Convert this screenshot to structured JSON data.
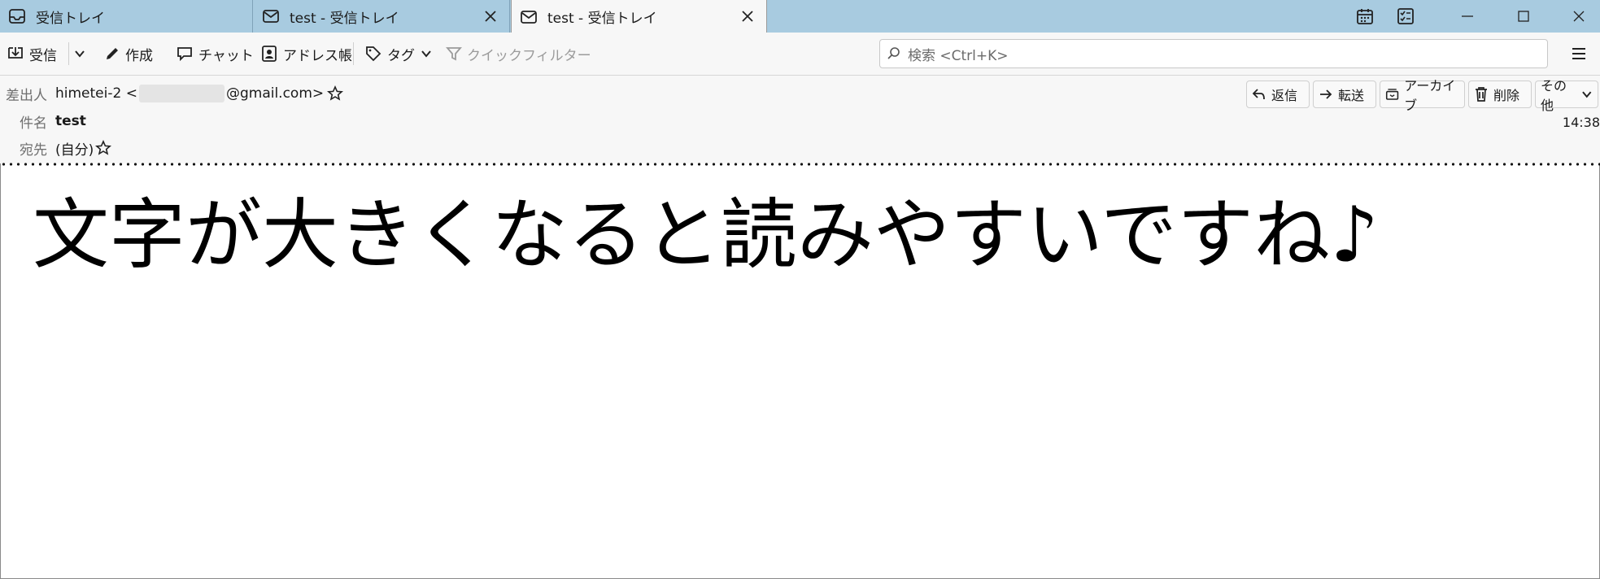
{
  "tabs": [
    {
      "label": "受信トレイ",
      "icon": "inbox-icon"
    },
    {
      "label": "test - 受信トレイ",
      "icon": "mail-icon"
    },
    {
      "label": "test - 受信トレイ",
      "icon": "mail-icon",
      "active": true
    }
  ],
  "window_controls": [
    "calendar-icon",
    "tasks-icon",
    "minimize-icon",
    "maximize-icon",
    "close-icon"
  ],
  "toolbar": {
    "get_messages": "受信",
    "write": "作成",
    "chat": "チャット",
    "address_book": "アドレス帳",
    "tag": "タグ",
    "quick_filter": "クイックフィルター",
    "search_placeholder": "検索 <Ctrl+K>"
  },
  "message": {
    "from_label": "差出人",
    "from_name": "himetei-2 <",
    "from_domain": "@gmail.com>",
    "subject_label": "件名",
    "subject": "test",
    "to_label": "宛先",
    "to": "(自分)",
    "time": "14:38",
    "actions": {
      "reply": "返信",
      "forward": "転送",
      "archive": "アーカイブ",
      "delete": "削除",
      "more": "その他"
    },
    "body": "文字が大きくなると読みやすいですね♪"
  },
  "colors": {
    "tabbar_bg": "#a8cbe0",
    "toolbar_bg": "#f7f7f7",
    "header_bg": "#f7f7f7",
    "body_bg": "#ffffff"
  }
}
